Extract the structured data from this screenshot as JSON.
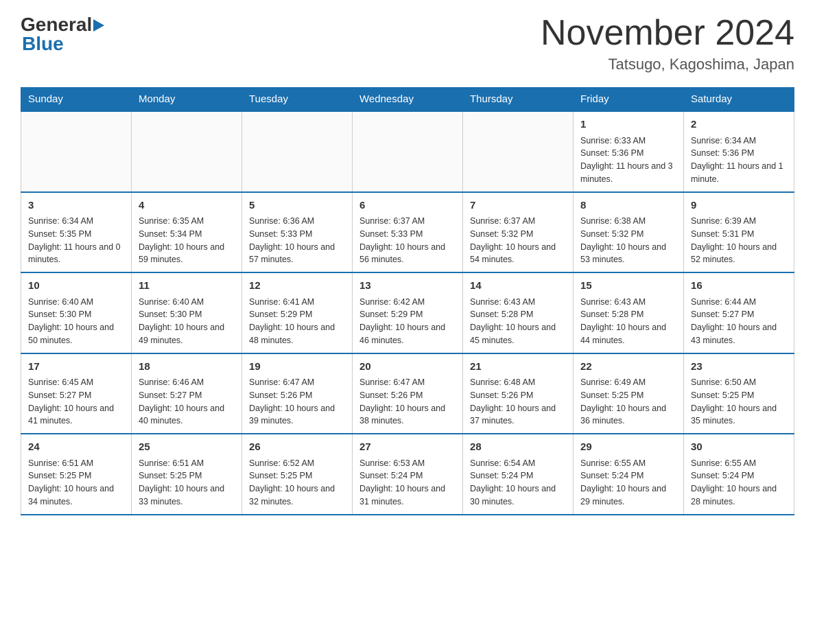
{
  "header": {
    "logo": {
      "general": "General",
      "blue": "Blue"
    },
    "title": "November 2024",
    "location": "Tatsugo, Kagoshima, Japan"
  },
  "days_of_week": [
    "Sunday",
    "Monday",
    "Tuesday",
    "Wednesday",
    "Thursday",
    "Friday",
    "Saturday"
  ],
  "weeks": [
    [
      {
        "day": "",
        "sunrise": "",
        "sunset": "",
        "daylight": ""
      },
      {
        "day": "",
        "sunrise": "",
        "sunset": "",
        "daylight": ""
      },
      {
        "day": "",
        "sunrise": "",
        "sunset": "",
        "daylight": ""
      },
      {
        "day": "",
        "sunrise": "",
        "sunset": "",
        "daylight": ""
      },
      {
        "day": "",
        "sunrise": "",
        "sunset": "",
        "daylight": ""
      },
      {
        "day": "1",
        "sunrise": "Sunrise: 6:33 AM",
        "sunset": "Sunset: 5:36 PM",
        "daylight": "Daylight: 11 hours and 3 minutes."
      },
      {
        "day": "2",
        "sunrise": "Sunrise: 6:34 AM",
        "sunset": "Sunset: 5:36 PM",
        "daylight": "Daylight: 11 hours and 1 minute."
      }
    ],
    [
      {
        "day": "3",
        "sunrise": "Sunrise: 6:34 AM",
        "sunset": "Sunset: 5:35 PM",
        "daylight": "Daylight: 11 hours and 0 minutes."
      },
      {
        "day": "4",
        "sunrise": "Sunrise: 6:35 AM",
        "sunset": "Sunset: 5:34 PM",
        "daylight": "Daylight: 10 hours and 59 minutes."
      },
      {
        "day": "5",
        "sunrise": "Sunrise: 6:36 AM",
        "sunset": "Sunset: 5:33 PM",
        "daylight": "Daylight: 10 hours and 57 minutes."
      },
      {
        "day": "6",
        "sunrise": "Sunrise: 6:37 AM",
        "sunset": "Sunset: 5:33 PM",
        "daylight": "Daylight: 10 hours and 56 minutes."
      },
      {
        "day": "7",
        "sunrise": "Sunrise: 6:37 AM",
        "sunset": "Sunset: 5:32 PM",
        "daylight": "Daylight: 10 hours and 54 minutes."
      },
      {
        "day": "8",
        "sunrise": "Sunrise: 6:38 AM",
        "sunset": "Sunset: 5:32 PM",
        "daylight": "Daylight: 10 hours and 53 minutes."
      },
      {
        "day": "9",
        "sunrise": "Sunrise: 6:39 AM",
        "sunset": "Sunset: 5:31 PM",
        "daylight": "Daylight: 10 hours and 52 minutes."
      }
    ],
    [
      {
        "day": "10",
        "sunrise": "Sunrise: 6:40 AM",
        "sunset": "Sunset: 5:30 PM",
        "daylight": "Daylight: 10 hours and 50 minutes."
      },
      {
        "day": "11",
        "sunrise": "Sunrise: 6:40 AM",
        "sunset": "Sunset: 5:30 PM",
        "daylight": "Daylight: 10 hours and 49 minutes."
      },
      {
        "day": "12",
        "sunrise": "Sunrise: 6:41 AM",
        "sunset": "Sunset: 5:29 PM",
        "daylight": "Daylight: 10 hours and 48 minutes."
      },
      {
        "day": "13",
        "sunrise": "Sunrise: 6:42 AM",
        "sunset": "Sunset: 5:29 PM",
        "daylight": "Daylight: 10 hours and 46 minutes."
      },
      {
        "day": "14",
        "sunrise": "Sunrise: 6:43 AM",
        "sunset": "Sunset: 5:28 PM",
        "daylight": "Daylight: 10 hours and 45 minutes."
      },
      {
        "day": "15",
        "sunrise": "Sunrise: 6:43 AM",
        "sunset": "Sunset: 5:28 PM",
        "daylight": "Daylight: 10 hours and 44 minutes."
      },
      {
        "day": "16",
        "sunrise": "Sunrise: 6:44 AM",
        "sunset": "Sunset: 5:27 PM",
        "daylight": "Daylight: 10 hours and 43 minutes."
      }
    ],
    [
      {
        "day": "17",
        "sunrise": "Sunrise: 6:45 AM",
        "sunset": "Sunset: 5:27 PM",
        "daylight": "Daylight: 10 hours and 41 minutes."
      },
      {
        "day": "18",
        "sunrise": "Sunrise: 6:46 AM",
        "sunset": "Sunset: 5:27 PM",
        "daylight": "Daylight: 10 hours and 40 minutes."
      },
      {
        "day": "19",
        "sunrise": "Sunrise: 6:47 AM",
        "sunset": "Sunset: 5:26 PM",
        "daylight": "Daylight: 10 hours and 39 minutes."
      },
      {
        "day": "20",
        "sunrise": "Sunrise: 6:47 AM",
        "sunset": "Sunset: 5:26 PM",
        "daylight": "Daylight: 10 hours and 38 minutes."
      },
      {
        "day": "21",
        "sunrise": "Sunrise: 6:48 AM",
        "sunset": "Sunset: 5:26 PM",
        "daylight": "Daylight: 10 hours and 37 minutes."
      },
      {
        "day": "22",
        "sunrise": "Sunrise: 6:49 AM",
        "sunset": "Sunset: 5:25 PM",
        "daylight": "Daylight: 10 hours and 36 minutes."
      },
      {
        "day": "23",
        "sunrise": "Sunrise: 6:50 AM",
        "sunset": "Sunset: 5:25 PM",
        "daylight": "Daylight: 10 hours and 35 minutes."
      }
    ],
    [
      {
        "day": "24",
        "sunrise": "Sunrise: 6:51 AM",
        "sunset": "Sunset: 5:25 PM",
        "daylight": "Daylight: 10 hours and 34 minutes."
      },
      {
        "day": "25",
        "sunrise": "Sunrise: 6:51 AM",
        "sunset": "Sunset: 5:25 PM",
        "daylight": "Daylight: 10 hours and 33 minutes."
      },
      {
        "day": "26",
        "sunrise": "Sunrise: 6:52 AM",
        "sunset": "Sunset: 5:25 PM",
        "daylight": "Daylight: 10 hours and 32 minutes."
      },
      {
        "day": "27",
        "sunrise": "Sunrise: 6:53 AM",
        "sunset": "Sunset: 5:24 PM",
        "daylight": "Daylight: 10 hours and 31 minutes."
      },
      {
        "day": "28",
        "sunrise": "Sunrise: 6:54 AM",
        "sunset": "Sunset: 5:24 PM",
        "daylight": "Daylight: 10 hours and 30 minutes."
      },
      {
        "day": "29",
        "sunrise": "Sunrise: 6:55 AM",
        "sunset": "Sunset: 5:24 PM",
        "daylight": "Daylight: 10 hours and 29 minutes."
      },
      {
        "day": "30",
        "sunrise": "Sunrise: 6:55 AM",
        "sunset": "Sunset: 5:24 PM",
        "daylight": "Daylight: 10 hours and 28 minutes."
      }
    ]
  ]
}
